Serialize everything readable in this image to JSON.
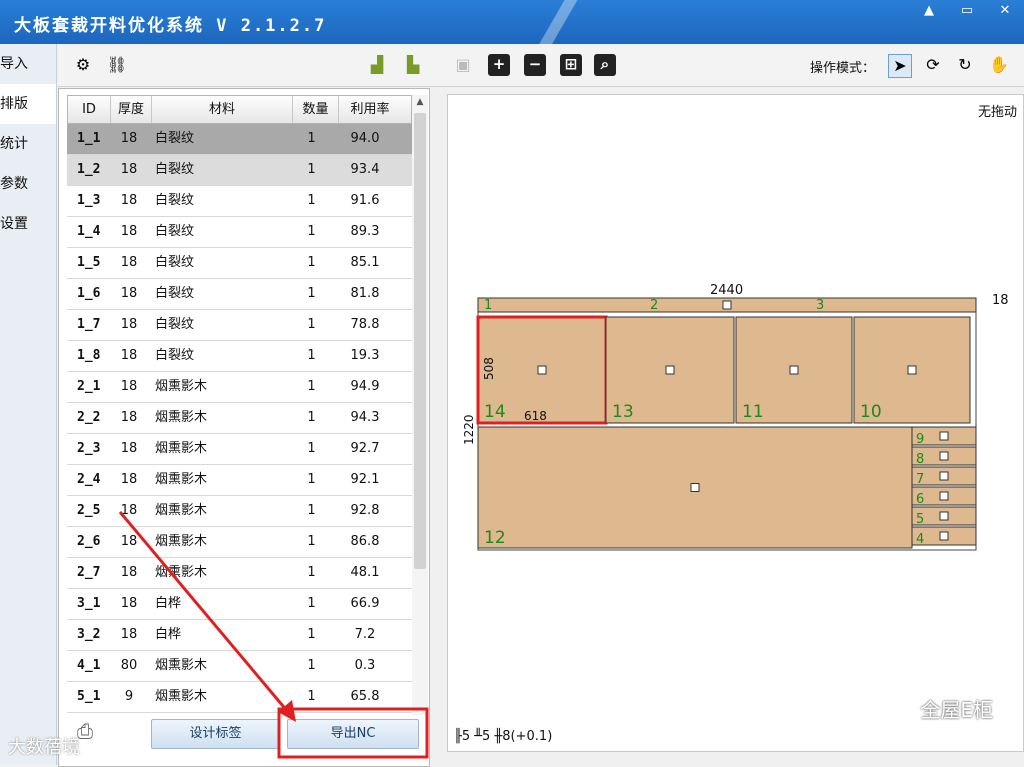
{
  "window": {
    "title": "大板套裁开料优化系统 V 2.1.2.7",
    "controls": [
      "▲",
      "▭",
      "✕"
    ]
  },
  "sidebar": {
    "items": [
      {
        "label": "导入"
      },
      {
        "label": "排版"
      },
      {
        "label": "统计"
      },
      {
        "label": "参数"
      },
      {
        "label": "设置"
      }
    ]
  },
  "toolbar": {
    "mode_label": "操作模式："
  },
  "table": {
    "headers": [
      "ID",
      "厚度",
      "材料",
      "数量",
      "利用率"
    ],
    "rows": [
      {
        "id": "1_1",
        "thickness": "18",
        "material": "白裂纹",
        "qty": "1",
        "rate": "94.0"
      },
      {
        "id": "1_2",
        "thickness": "18",
        "material": "白裂纹",
        "qty": "1",
        "rate": "93.4"
      },
      {
        "id": "1_3",
        "thickness": "18",
        "material": "白裂纹",
        "qty": "1",
        "rate": "91.6"
      },
      {
        "id": "1_4",
        "thickness": "18",
        "material": "白裂纹",
        "qty": "1",
        "rate": "89.3"
      },
      {
        "id": "1_5",
        "thickness": "18",
        "material": "白裂纹",
        "qty": "1",
        "rate": "85.1"
      },
      {
        "id": "1_6",
        "thickness": "18",
        "material": "白裂纹",
        "qty": "1",
        "rate": "81.8"
      },
      {
        "id": "1_7",
        "thickness": "18",
        "material": "白裂纹",
        "qty": "1",
        "rate": "78.8"
      },
      {
        "id": "1_8",
        "thickness": "18",
        "material": "白裂纹",
        "qty": "1",
        "rate": "19.3"
      },
      {
        "id": "2_1",
        "thickness": "18",
        "material": "烟熏影木",
        "qty": "1",
        "rate": "94.9"
      },
      {
        "id": "2_2",
        "thickness": "18",
        "material": "烟熏影木",
        "qty": "1",
        "rate": "94.3"
      },
      {
        "id": "2_3",
        "thickness": "18",
        "material": "烟熏影木",
        "qty": "1",
        "rate": "92.7"
      },
      {
        "id": "2_4",
        "thickness": "18",
        "material": "烟熏影木",
        "qty": "1",
        "rate": "92.1"
      },
      {
        "id": "2_5",
        "thickness": "18",
        "material": "烟熏影木",
        "qty": "1",
        "rate": "92.8"
      },
      {
        "id": "2_6",
        "thickness": "18",
        "material": "烟熏影木",
        "qty": "1",
        "rate": "86.8"
      },
      {
        "id": "2_7",
        "thickness": "18",
        "material": "烟熏影木",
        "qty": "1",
        "rate": "48.1"
      },
      {
        "id": "3_1",
        "thickness": "18",
        "material": "白桦",
        "qty": "1",
        "rate": "66.9"
      },
      {
        "id": "3_2",
        "thickness": "18",
        "material": "白桦",
        "qty": "1",
        "rate": "7.2"
      },
      {
        "id": "4_1",
        "thickness": "80",
        "material": "烟熏影木",
        "qty": "1",
        "rate": "0.3"
      },
      {
        "id": "5_1",
        "thickness": "9",
        "material": "烟熏影木",
        "qty": "1",
        "rate": "65.8"
      }
    ]
  },
  "buttons": {
    "design_label": "设计标签",
    "export_nc": "导出NC"
  },
  "canvas": {
    "drag_status": "无拖动",
    "board_width": "2440",
    "board_height": "1220",
    "board_thickness": "18",
    "part_width": "618",
    "part_height": "508",
    "status_bar": "╟5 ╨5 ╫8(+0.1)",
    "parts": [
      {
        "n": "1"
      },
      {
        "n": "2"
      },
      {
        "n": "3"
      },
      {
        "n": "14"
      },
      {
        "n": "13"
      },
      {
        "n": "11"
      },
      {
        "n": "10"
      },
      {
        "n": "12"
      },
      {
        "n": "9"
      },
      {
        "n": "8"
      },
      {
        "n": "7"
      },
      {
        "n": "6"
      },
      {
        "n": "5"
      },
      {
        "n": "4"
      }
    ],
    "colors": {
      "part": "#deb88f",
      "label": "#1b8a1b",
      "highlight": "#e02020"
    }
  },
  "watermark": {
    "right": "全屋E柜",
    "left": "大数蓓境"
  }
}
